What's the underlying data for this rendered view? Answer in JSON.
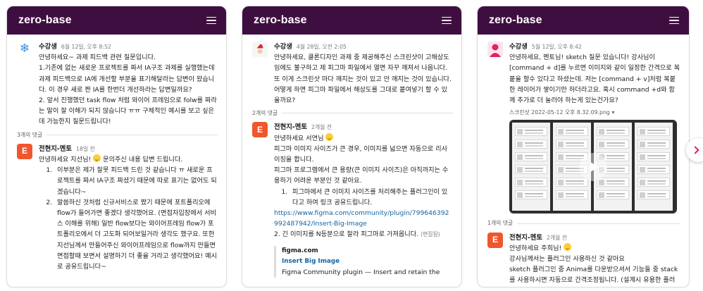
{
  "cards": [
    {
      "brand": "zero-base",
      "question": {
        "avatar_icon": "snowflake-icon",
        "author": "수강생",
        "time": "6월 12일, 오후 8:52",
        "lines": [
          "안녕하세요~ 과제 피드백 관련 질문입니다.",
          "1.기존에 없는 새로운 프로젝트를 짜서 IA구조 과제를 실행했는데 과제 피드백으로 IA에 개선할 부분을 표기해달라는 답변이 왔습니다. 이 경우 새로 짠 IA를 한번더 개선하라는 답변일까요?",
          "2. 앞서 진행했던 task flow 처럼 와이어 프레임으로 folw를 짜라는 말이 잘 이해가 되지 않습니다 ㅠㅠ 구체적인 예시를 보고 싶은데 가능한지 질문드립니다!"
        ]
      },
      "replies_label": "3개의 댓글",
      "reply": {
        "avatar_letter": "E",
        "author": "전현지-멘토",
        "time": "18일 전",
        "intro": "안녕하세요 지선님!",
        "intro_after": " 문의주신 내용 답변 드립니다.",
        "items": [
          "이부분은 제가 잘못 피드백 드린 것 같습니다 ㅠ 새로운 프로젝트를 짜서 IA구조 짜셨기 때문에 따로 표기는 없어도 되겠습니다~",
          "말씀하신 것처럼 신규서비스로 짰기 때문에 포트폴리오에 flow가 들어가면 좋겠다 생각했어요. (면접자입장에서 서비스 이해를 위해) 일반 flow보다는 와이어프레임 flow가 포트폴리오에서 더 고도화 되어보일거라 생각도 했구요. 또한 지선님께서 만들어주신 와이어프레임으로 flow까지 만들면 면접할때 보면서 설명하기 더 좋을 거라고 생각했어요!  예시로 공유드립니다~"
        ]
      }
    },
    {
      "brand": "zero-base",
      "question": {
        "avatar_icon": "santa-avatar-icon",
        "author": "수강생",
        "time": "4월 28일, 오전 2:05",
        "lines": [
          "안녕하세요, 클론디자인 과제 중 제공해주신 스크린샷이 고해상도임에도 불구하고 제 피그마 파일에서 열면 자꾸 깨져서 나옵니다. 또 이게 스크린샷 마다 깨지는 것이 있고 안 깨지는 것이 있습니다. 어떻게 하면 피그마 파일에서 해상도를 그대로 붙여넣기 할 수 있을까요?"
        ]
      },
      "replies_label": "2개의 댓글",
      "reply": {
        "avatar_letter": "E",
        "author": "전현지-멘토",
        "time": "2개월 전",
        "intro": "안녕하세요 서연님",
        "lines": [
          "피그마 이미지 사이즈가 큰 경우, 이미지를 넓으면 자동으로 리사이징을 합니다.",
          "피그마 프로그램에서 큰 용량(큰 이미지 사이즈)은 아직까지는 수용하기 어려운 부분인 것 같아요."
        ],
        "items": [
          "피그마에서 큰 이미지 사이즈를 처리해주는 플러그인이 있다고 하여 링크 공유드립니다."
        ],
        "link": "https://www.figma.com/community/plugin/799646392992487942/Insert-Big-Image",
        "item2": "2. 긴 이미지를 N등분으로 잘라 피그마로 가져옵니다.",
        "edited": "(편집됨)",
        "preview": {
          "site": "figma.com",
          "title": "Insert Big Image",
          "desc": "Figma Community plugin — Insert and retain the"
        }
      }
    },
    {
      "brand": "zero-base",
      "question": {
        "avatar_icon": "user-avatar-icon",
        "author": "수강생",
        "time": "5월 12일, 오후 8:42",
        "lines": [
          "안녕하세요, 멘토님! sketch 질문 있습니다! 강사님이 [command + d]를 누르면 이미지와 같이 일정한 간격으로 복붙을 할수 있다고 하셨는데. 저는 [command + v]처럼 복붙한 레이어가 쌓이기만 하더라고요. 혹시 command +d와 함께 추가로 더 눌러야 하는게 있는건가요?"
        ],
        "attachment": "스크린샷 2022-05-12 오후 8.32.09.png"
      },
      "replies_label": "1개의 댓글",
      "reply": {
        "avatar_letter": "E",
        "author": "전현지-멘토",
        "time": "2개월 전",
        "intro": "안녕하세요 주희님!",
        "lines": [
          "강사님께서는 플러그인 사용하신 것 같아요",
          "sketch 플러그인 중 Anima를 다운받으셔서 기능들 중 stack를 사용하시면 자동으로 간격조정됩니다. (설계시 유용한 플러그"
        ]
      }
    }
  ],
  "colors": {
    "header": "#3f0e40",
    "accent": "#e01e5a",
    "mentor_avatar": "#f0562d",
    "link": "#1264a3"
  }
}
